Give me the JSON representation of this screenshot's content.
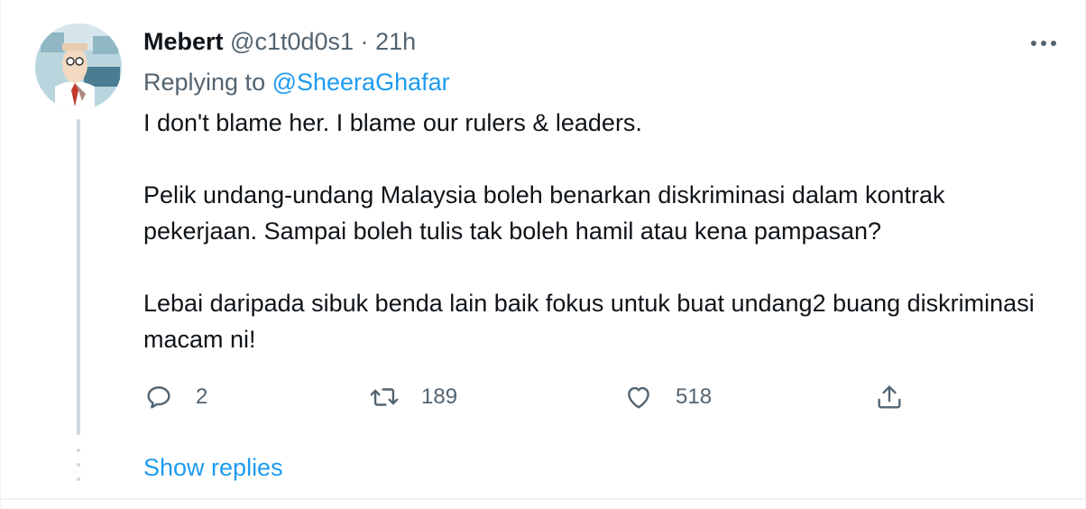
{
  "tweet": {
    "author_name": "Mebert",
    "author_handle": "@c1t0d0s1",
    "separator": "·",
    "time": "21h",
    "replying_prefix": "Replying to ",
    "replying_to": "@SheeraGhafar",
    "paragraphs": [
      "I don't blame her. I blame our rulers & leaders.",
      "Pelik undang-undang Malaysia boleh benarkan diskriminasi dalam kontrak pekerjaan. Sampai boleh tulis tak boleh hamil atau kena pampasan?",
      "Lebai daripada sibuk benda lain baik fokus untuk buat undang2 buang diskriminasi macam ni!"
    ],
    "actions": {
      "reply_count": "2",
      "retweet_count": "189",
      "like_count": "518"
    },
    "show_replies": "Show replies"
  },
  "colors": {
    "text": "#0f1419",
    "secondary": "#536471",
    "accent": "#1d9bf0",
    "border": "#eff3f4",
    "thread_line": "#cfd9de"
  },
  "icons": [
    "more-icon",
    "reply-icon",
    "retweet-icon",
    "like-icon",
    "share-icon"
  ]
}
